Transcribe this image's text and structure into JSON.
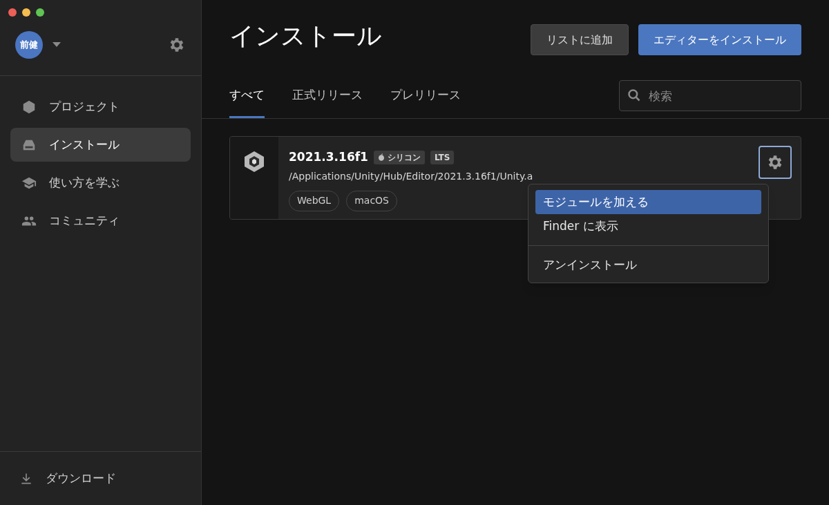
{
  "user": {
    "initials": "前健"
  },
  "sidebar": {
    "items": [
      {
        "label": "プロジェクト",
        "kind": "cube",
        "selected": false
      },
      {
        "label": "インストール",
        "kind": "drive",
        "selected": true
      },
      {
        "label": "使い方を学ぶ",
        "kind": "cap",
        "selected": false
      },
      {
        "label": "コミュニティ",
        "kind": "people",
        "selected": false
      }
    ],
    "footer": {
      "label": "ダウンロード"
    }
  },
  "page": {
    "title": "インストール",
    "buttons": [
      {
        "label": "リストに追加",
        "kind": "secondary"
      },
      {
        "label": "エディターをインストール",
        "kind": "primary"
      }
    ]
  },
  "tabs": [
    {
      "label": "すべて",
      "selected": true
    },
    {
      "label": "正式リリース",
      "selected": false
    },
    {
      "label": "プレリリース",
      "selected": false
    }
  ],
  "search": {
    "placeholder": "検索"
  },
  "installs": [
    {
      "version": "2021.3.16f1",
      "badges": [
        {
          "label": "シリコン",
          "kind": "apple"
        },
        {
          "label": "LTS",
          "kind": "plain"
        }
      ],
      "path": "/Applications/Unity/Hub/Editor/2021.3.16f1/Unity.a",
      "modules": [
        "WebGL",
        "macOS"
      ]
    }
  ],
  "context_menu": {
    "items": [
      {
        "label": "モジュールを加える",
        "selected": true,
        "kind": "item"
      },
      {
        "label": "Finder に表示",
        "selected": false,
        "kind": "item"
      },
      {
        "kind": "separator"
      },
      {
        "label": "アンインストール",
        "selected": false,
        "kind": "item"
      }
    ]
  }
}
